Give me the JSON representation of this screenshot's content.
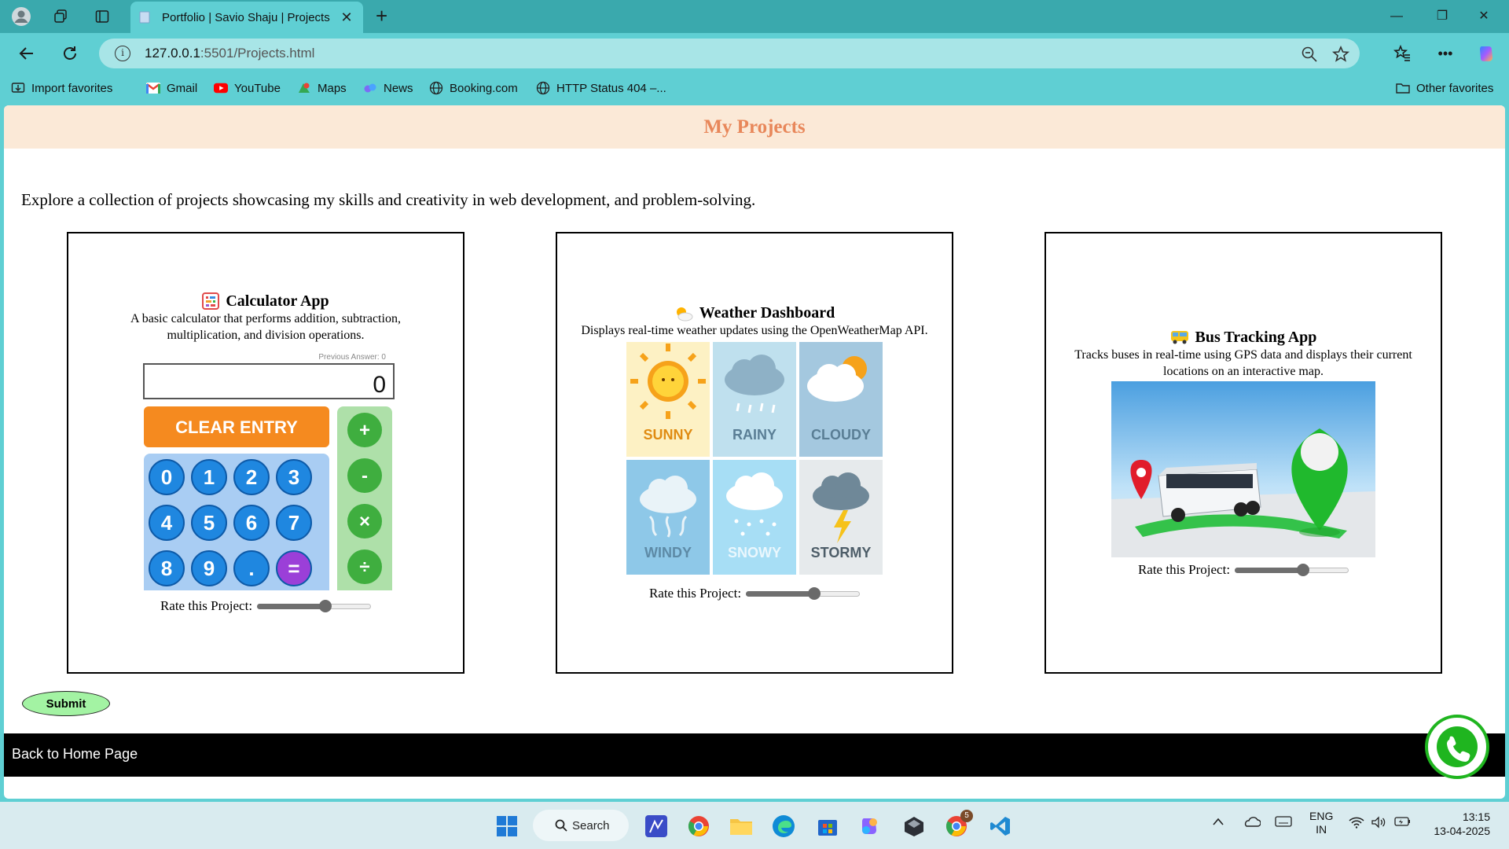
{
  "browser": {
    "tab_title": "Portfolio | Savio Shaju | Projects",
    "url_host": "127.0.0.1",
    "url_rest": ":5501/Projects.html",
    "bookmarks": [
      "Import favorites",
      "Gmail",
      "YouTube",
      "Maps",
      "News",
      "Booking.com",
      "HTTP Status 404 –..."
    ],
    "other_favorites": "Other favorites"
  },
  "page": {
    "title": "My Projects",
    "intro": "Explore a collection of projects showcasing my skills and creativity in web development, and problem-solving.",
    "projects": [
      {
        "title": "Calculator App",
        "description": "A basic calculator that performs addition, subtraction, multiplication, and division operations.",
        "rate_label": "Rate this Project:",
        "rating": 0.6,
        "image": {
          "prev_answer": "Previous Answer: 0",
          "display": "0",
          "clear": "CLEAR ENTRY",
          "digits": [
            "0",
            "1",
            "2",
            "3",
            "4",
            "5",
            "6",
            "7",
            "8",
            "9",
            ".",
            "="
          ],
          "ops": [
            "+",
            "-",
            "×",
            "÷"
          ]
        }
      },
      {
        "title": "Weather Dashboard",
        "description": "Displays real-time weather updates using the OpenWeatherMap API.",
        "rate_label": "Rate this Project:",
        "rating": 0.6,
        "image": {
          "tiles": [
            "SUNNY",
            "RAINY",
            "CLOUDY",
            "WINDY",
            "SNOWY",
            "STORMY"
          ]
        }
      },
      {
        "title": "Bus Tracking App",
        "description": "Tracks buses in real-time using GPS data and displays their current locations on an interactive map.",
        "rate_label": "Rate this Project:",
        "rating": 0.6
      }
    ],
    "submit": "Submit",
    "footer_link": "Back to Home Page"
  },
  "taskbar": {
    "search": "Search",
    "lang1": "ENG",
    "lang2": "IN",
    "time": "13:15",
    "date": "13-04-2025",
    "badge": "5"
  },
  "colors": {
    "accent": "#e8875a",
    "header_bg": "#fbe9d7",
    "submit_bg": "#a3f3a3",
    "browser_frame": "#5fcfd3"
  }
}
